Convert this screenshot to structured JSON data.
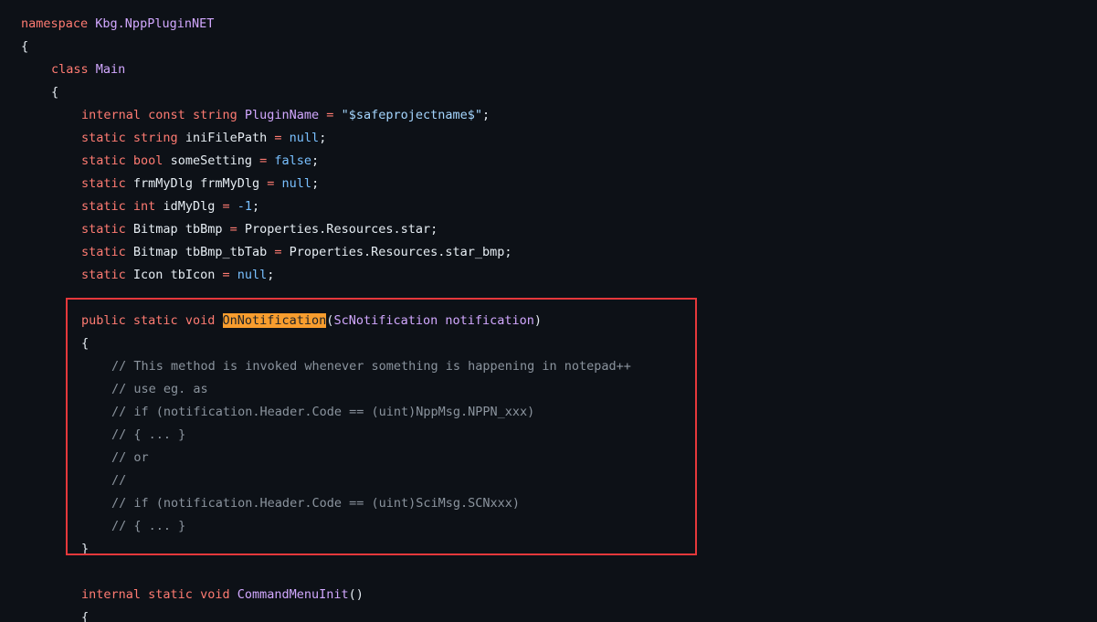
{
  "code": {
    "ns_kw": "namespace",
    "ns_name": "Kbg.NppPluginNET",
    "brace_open": "{",
    "brace_close": "}",
    "class_kw": "class",
    "class_name": "Main",
    "f1_internal": "internal",
    "f1_const": "const",
    "f1_type": "string",
    "f1_name": "PluginName",
    "f1_value": "\"$safeprojectname$\"",
    "static_kw": "static",
    "f2_type": "string",
    "f2_name": "iniFilePath",
    "null_kw": "null",
    "f3_type": "bool",
    "f3_name": "someSetting",
    "false_kw": "false",
    "f4_type": "frmMyDlg",
    "f4_name": "frmMyDlg",
    "f5_type": "int",
    "f5_name": "idMyDlg",
    "f5_value": "-1",
    "f6_type": "Bitmap",
    "f6_name": "tbBmp",
    "f6_value": "Properties.Resources.star;",
    "f7_type": "Bitmap",
    "f7_name": "tbBmp_tbTab",
    "f7_value": "Properties.Resources.star_bmp;",
    "f8_type": "Icon",
    "f8_name": "tbIcon",
    "public_kw": "public",
    "void_kw": "void",
    "m1_name": "OnNotification",
    "m1_param_type": "ScNotification",
    "m1_param_name": "notification",
    "comments": [
      "// This method is invoked whenever something is happening in notepad++",
      "// use eg. as",
      "// if (notification.Header.Code == (uint)NppMsg.NPPN_xxx)",
      "// { ... }",
      "// or",
      "//",
      "// if (notification.Header.Code == (uint)SciMsg.SCNxxx)",
      "// { ... }"
    ],
    "internal_kw": "internal",
    "m2_name": "CommandMenuInit",
    "m2_parens": "()"
  }
}
